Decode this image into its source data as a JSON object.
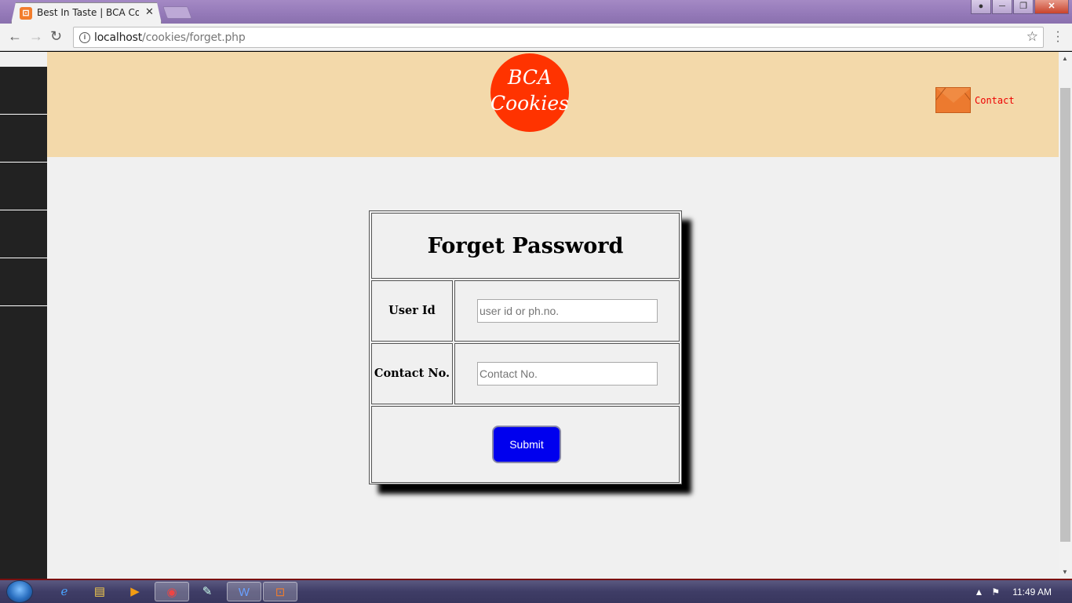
{
  "browser": {
    "tab_title": "Best In Taste | BCA Cooki",
    "url_host": "localhost",
    "url_path": "/cookies/forget.php"
  },
  "header": {
    "logo_line1": "BCA",
    "logo_line2": "Cookies",
    "contact_label": "Contact"
  },
  "form": {
    "title": "Forget Password",
    "user_id_label": "User Id",
    "user_id_placeholder": "user id or ph.no.",
    "contact_label": "Contact No.",
    "contact_placeholder": "Contact No.",
    "submit_label": "Submit"
  },
  "taskbar": {
    "clock": "11:49 AM"
  },
  "colors": {
    "header_bg": "#f3d9aa",
    "logo_bg": "#ff3300",
    "submit_bg": "#0000ee",
    "sidebar_bg": "#222222",
    "contact_text": "#ee0000"
  },
  "icons": [
    "favicon-icon",
    "close-icon",
    "back-icon",
    "forward-icon",
    "reload-icon",
    "info-icon",
    "star-icon",
    "menu-icon",
    "mail-icon",
    "start-icon",
    "ie-icon",
    "folder-icon",
    "media-player-icon",
    "chrome-icon",
    "notepad-icon",
    "word-icon",
    "xampp-icon",
    "flag-icon"
  ]
}
